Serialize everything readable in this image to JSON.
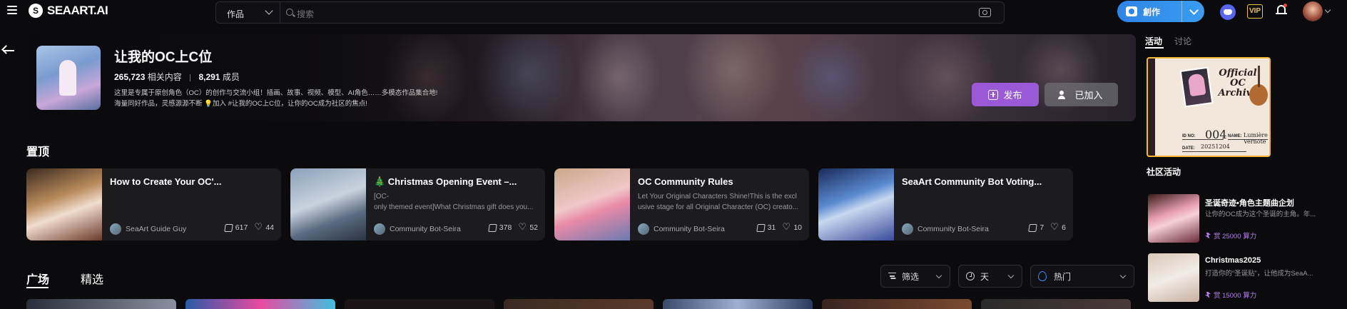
{
  "header": {
    "logo_mark": "S",
    "logo_text": "SEAART.AI",
    "search_scope": "作品",
    "search_placeholder": "搜索",
    "create_label": "創作",
    "vip_label": "VIP",
    "accent_color": "#2f84e6"
  },
  "group": {
    "title": "让我的OC上C位",
    "content_count": "265,723",
    "content_label": "相关内容",
    "member_count": "8,291",
    "member_label": "成员",
    "description_line1": "这里是专属于原创角色（OC）的创作与交流小组！插画、故事、视频、模型、AI角色……多模态作品集合地!",
    "description_line2": "海量同好作品，灵感源源不断 💡加入 #让我的OC上C位，让你的OC成为社区的焦点!",
    "publish_label": "发布",
    "joined_label": "已加入"
  },
  "pinned": {
    "title": "置顶",
    "items": [
      {
        "title": "How to Create Your OC'...",
        "excerpt1": "",
        "excerpt2": "",
        "author": "SeaArt Guide Guy",
        "likes": "617",
        "hearts": "44"
      },
      {
        "title": "🎄 Christmas Opening Event –...",
        "excerpt1": "[OC-",
        "excerpt2": "only themed event]What Christmas gift does you...",
        "author": "Community Bot-Seira",
        "likes": "378",
        "hearts": "52"
      },
      {
        "title": "OC Community Rules",
        "excerpt1": "Let Your Original Characters Shine!This is the excl",
        "excerpt2": "usive stage for all Original Character (OC) creato...",
        "author": "Community Bot-Seira",
        "likes": "31",
        "hearts": "10"
      },
      {
        "title": "SeaArt Community Bot Voting...",
        "excerpt1": "",
        "excerpt2": "",
        "author": "Community Bot-Seira",
        "likes": "7",
        "hearts": "6"
      }
    ]
  },
  "feed_tabs": {
    "plaza": "广场",
    "featured": "精选"
  },
  "filters": {
    "filter": "筛选",
    "time": "天",
    "sort": "热门"
  },
  "sidebar": {
    "tab_activity": "活动",
    "tab_discussion": "讨论",
    "archive": {
      "title_line1": "Official",
      "title_line2": "OC",
      "title_line3": "Archive",
      "id_label": "ID NO:",
      "id_value": "004",
      "name_label": "NAME:",
      "name_value": "Lumière Vernote",
      "date_label": "DATE:",
      "date_value": "20251204"
    },
    "community_title": "社区活动",
    "activities": [
      {
        "title": "圣诞奇迹•角色主题曲企划",
        "desc": "让你的OC成为这个圣诞的主角。年...",
        "prize": "赏 25000 算力"
      },
      {
        "title": "Christmas2025",
        "desc": "打造你的“圣诞贴”，让他成为SeaA...",
        "prize": "赏 15000 算力"
      }
    ]
  }
}
